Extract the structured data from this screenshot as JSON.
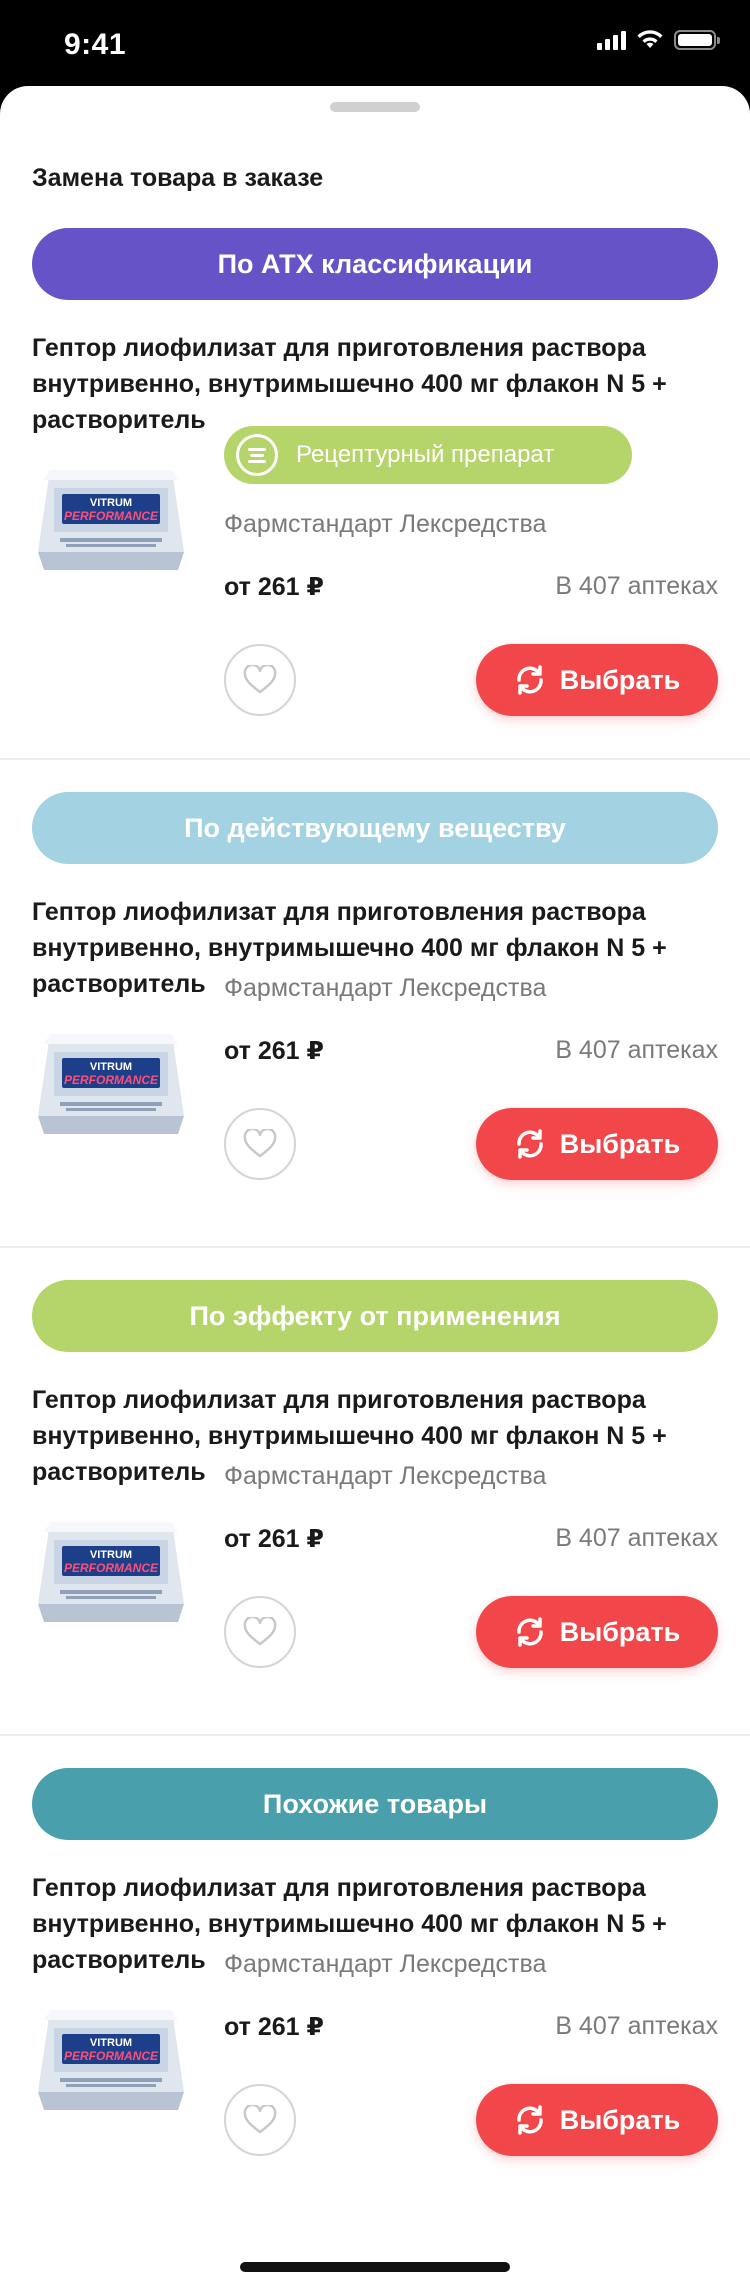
{
  "status_bar": {
    "time": "9:41"
  },
  "sheet": {
    "title": "Замена товара в заказе"
  },
  "sections": [
    {
      "category": "По АТХ классификации",
      "color": "#6653c8",
      "product": {
        "name": "Гептор лиофилизат для приготовления раствора внутривенно, внутримышечно 400 мг флакон N 5 + растворитель",
        "badge": "Рецептурный препарат",
        "manufacturer": "Фармстандарт Лексредства",
        "price": "от 261 ₽",
        "availability": "В 407 аптеках",
        "select_label": "Выбрать",
        "image_brand": "VITRUM",
        "image_title": "PERFORMANCE"
      }
    },
    {
      "category": "По действующему веществу",
      "color": "#a3d2e3",
      "product": {
        "name": "Гептор лиофилизат для приготовления раствора внутривенно, внутримышечно 400 мг флакон N 5 + растворитель",
        "manufacturer": "Фармстандарт Лексредства",
        "price": "от 261 ₽",
        "availability": "В 407 аптеках",
        "select_label": "Выбрать",
        "image_brand": "VITRUM",
        "image_title": "PERFORMANCE"
      }
    },
    {
      "category": "По эффекту от применения",
      "color": "#b5d46a",
      "product": {
        "name": "Гептор лиофилизат для приготовления раствора внутривенно, внутримышечно 400 мг флакон N 5 + растворитель",
        "manufacturer": "Фармстандарт Лексредства",
        "price": "от 261 ₽",
        "availability": "В 407 аптеках",
        "select_label": "Выбрать",
        "image_brand": "VITRUM",
        "image_title": "PERFORMANCE"
      }
    },
    {
      "category": "Похожие товары",
      "color": "#4a9fad",
      "product": {
        "name": "Гептор лиофилизат для приготовления раствора внутривенно, внутримышечно 400 мг флакон N 5 + растворитель",
        "manufacturer": "Фармстандарт Лексредства",
        "price": "от 261 ₽",
        "availability": "В 407 аптеках",
        "select_label": "Выбрать",
        "image_brand": "VITRUM",
        "image_title": "PERFORMANCE"
      }
    }
  ],
  "colors": {
    "select_button": "#f2474a",
    "rx_badge": "#b5d46a"
  },
  "icons": [
    "prescription-icon",
    "heart-icon",
    "refresh-icon",
    "wifi-icon",
    "battery-icon",
    "signal-icon"
  ]
}
